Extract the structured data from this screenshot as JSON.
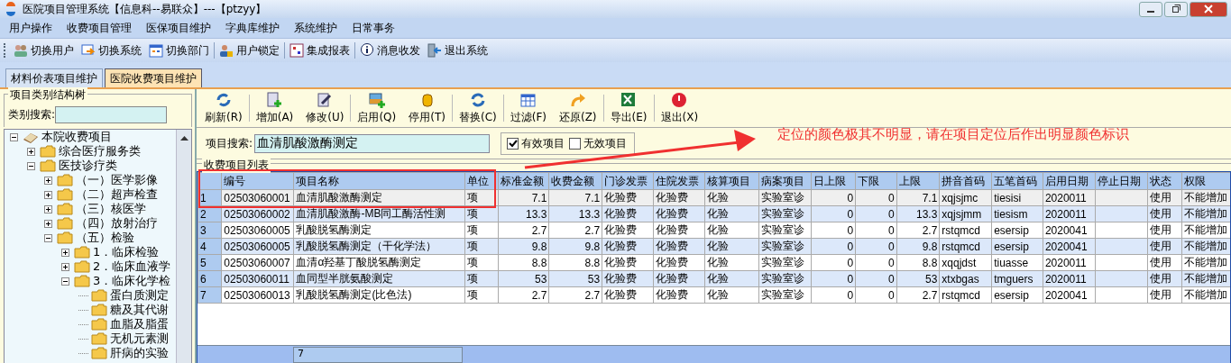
{
  "window": {
    "title": "医院项目管理系统【信息科--易联众】---【ptzyy】"
  },
  "menu": [
    "用户操作",
    "收费项目管理",
    "医保项目维护",
    "字典库维护",
    "系统维护",
    "日常事务"
  ],
  "toolbar": [
    {
      "label": "切换用户"
    },
    {
      "label": "切换系统"
    },
    {
      "label": "切换部门"
    },
    {
      "label": "用户锁定"
    },
    {
      "label": "集成报表"
    },
    {
      "label": "消息收发"
    },
    {
      "label": "退出系统"
    }
  ],
  "tabs": [
    {
      "label": "材料价表项目维护",
      "selected": false
    },
    {
      "label": "医院收费项目维护",
      "selected": true
    }
  ],
  "sidebar": {
    "title": "项目类别结构树",
    "search_label": "类别搜索:",
    "tree": [
      {
        "label": "本院收费项目",
        "expanded": true,
        "children": [
          {
            "label": "综合医疗服务类",
            "expanded": false
          },
          {
            "label": "医技诊疗类",
            "expanded": true,
            "children": [
              {
                "label": "（一）医学影像",
                "expanded": false
              },
              {
                "label": "（二）超声检查",
                "expanded": false
              },
              {
                "label": "（三）核医学",
                "expanded": false
              },
              {
                "label": "（四）放射治疗",
                "expanded": false
              },
              {
                "label": "（五）检验",
                "expanded": true,
                "children": [
                  {
                    "label": "1．临床检验",
                    "expanded": false
                  },
                  {
                    "label": "2．临床血液学",
                    "expanded": false
                  },
                  {
                    "label": "3．临床化学检",
                    "expanded": true,
                    "children": [
                      {
                        "label": "蛋白质测定"
                      },
                      {
                        "label": "糖及其代谢"
                      },
                      {
                        "label": "血脂及脂蛋"
                      },
                      {
                        "label": "无机元素测"
                      },
                      {
                        "label": "肝病的实验"
                      }
                    ]
                  }
                ]
              }
            ]
          }
        ]
      }
    ]
  },
  "actions": [
    {
      "label": "刷新(R)"
    },
    {
      "label": "增加(A)"
    },
    {
      "label": "修改(U)"
    },
    {
      "label": "启用(Q)"
    },
    {
      "label": "停用(T)"
    },
    {
      "label": "替换(C)"
    },
    {
      "label": "过滤(F)"
    },
    {
      "label": "还原(Z)"
    },
    {
      "label": "导出(E)"
    },
    {
      "label": "退出(X)"
    }
  ],
  "search": {
    "label": "项目搜索:",
    "value": "血清肌酸激酶测定"
  },
  "filters": [
    {
      "label": "有效项目",
      "checked": true
    },
    {
      "label": "无效项目",
      "checked": false
    }
  ],
  "table": {
    "title": "收费项目列表",
    "columns": [
      "编号",
      "项目名称",
      "单位",
      "标准金额",
      "收费金额",
      "门诊发票",
      "住院发票",
      "核算项目",
      "病案项目",
      "日上限",
      "下限",
      "上限",
      "拼音首码",
      "五笔首码",
      "启用日期",
      "停止日期",
      "状态",
      "权限"
    ],
    "rows": [
      {
        "number": "1",
        "selected": true,
        "cells": [
          "02503060001",
          "血清肌酸激酶测定",
          "项",
          "7.1",
          "7.1",
          "化验费",
          "化验费",
          "化验",
          "实验室诊",
          "0",
          "0",
          "7.1",
          "xqjsjmc",
          "tiesisi",
          "2020011",
          "",
          "使用",
          "不能增加"
        ]
      },
      {
        "number": "2",
        "selected": false,
        "cells": [
          "02503060002",
          "血清肌酸激酶-MB同工酶活性测",
          "项",
          "13.3",
          "13.3",
          "化验费",
          "化验费",
          "化验",
          "实验室诊",
          "0",
          "0",
          "13.3",
          "xqjsjmm",
          "tiesism",
          "2020011",
          "",
          "使用",
          "不能增加"
        ]
      },
      {
        "number": "3",
        "selected": false,
        "cells": [
          "02503060005",
          "乳酸脱氢酶测定",
          "项",
          "2.7",
          "2.7",
          "化验费",
          "化验费",
          "化验",
          "实验室诊",
          "0",
          "0",
          "2.7",
          "rstqmcd",
          "esersip",
          "2020041",
          "",
          "使用",
          "不能增加"
        ]
      },
      {
        "number": "4",
        "selected": false,
        "cells": [
          "02503060005",
          "乳酸脱氢酶测定（干化学法）",
          "项",
          "9.8",
          "9.8",
          "化验费",
          "化验费",
          "化验",
          "实验室诊",
          "0",
          "0",
          "9.8",
          "rstqmcd",
          "esersip",
          "2020041",
          "",
          "使用",
          "不能增加"
        ]
      },
      {
        "number": "5",
        "selected": false,
        "cells": [
          "02503060007",
          "血清α羟基丁酸脱氢酶测定",
          "项",
          "8.8",
          "8.8",
          "化验费",
          "化验费",
          "化验",
          "实验室诊",
          "0",
          "0",
          "8.8",
          "xqqjdst",
          "tiuasse",
          "2020011",
          "",
          "使用",
          "不能增加"
        ]
      },
      {
        "number": "6",
        "selected": false,
        "cells": [
          "02503060011",
          "血同型半胱氨酸测定",
          "项",
          "53",
          "53",
          "化验费",
          "化验费",
          "化验",
          "实验室诊",
          "0",
          "0",
          "53",
          "xtxbgas",
          "tmguers",
          "2020011",
          "",
          "使用",
          "不能增加"
        ]
      },
      {
        "number": "7",
        "selected": false,
        "cells": [
          "02503060013",
          "乳酸脱氢酶测定(比色法)",
          "项",
          "2.7",
          "2.7",
          "化验费",
          "化验费",
          "化验",
          "实验室诊",
          "0",
          "0",
          "2.7",
          "rstqmcd",
          "esersip",
          "2020041",
          "",
          "使用",
          "不能增加"
        ]
      }
    ],
    "footer_count": "7"
  },
  "annotation": {
    "text": "定位的颜色极其不明显，请在项目定位后作出明显颜色标识"
  }
}
